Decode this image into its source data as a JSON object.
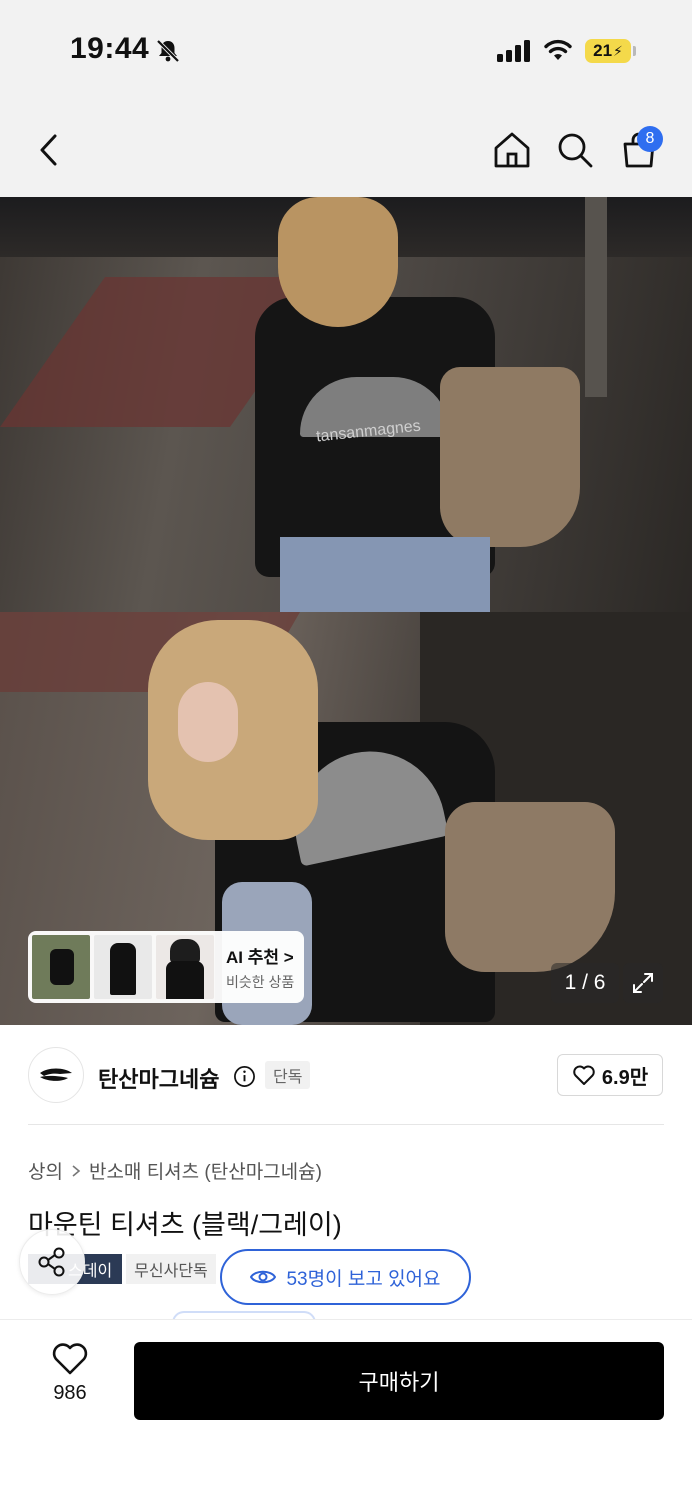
{
  "status_bar": {
    "time": "19:44",
    "battery": "21"
  },
  "nav": {
    "cart_count": "8"
  },
  "gallery": {
    "counter": "1 / 6",
    "ai_card": {
      "title": "AI 추천 >",
      "subtitle": "비슷한 상품"
    },
    "shirt_print_text": "tansanmagnes"
  },
  "brand": {
    "name": "탄산마그네슘",
    "exclusive_label": "단독",
    "likes": "6.9만"
  },
  "product": {
    "breadcrumb": [
      "상의",
      "반소매 티셔츠 (탄산마그네슘)"
    ],
    "title": "마운틴 티셔츠 (블랙/그레이)",
    "tags": [
      "스데이",
      "무신사단독"
    ],
    "viewers": "53명이 보고 있어요"
  },
  "bottom_bar": {
    "wish_count": "986",
    "buy_label": "구매하기"
  },
  "colors": {
    "accent_blue": "#2f63d8",
    "badge_blue": "#2f6ef0",
    "battery_yellow": "#f4d94a",
    "buy_button": "#000000"
  }
}
